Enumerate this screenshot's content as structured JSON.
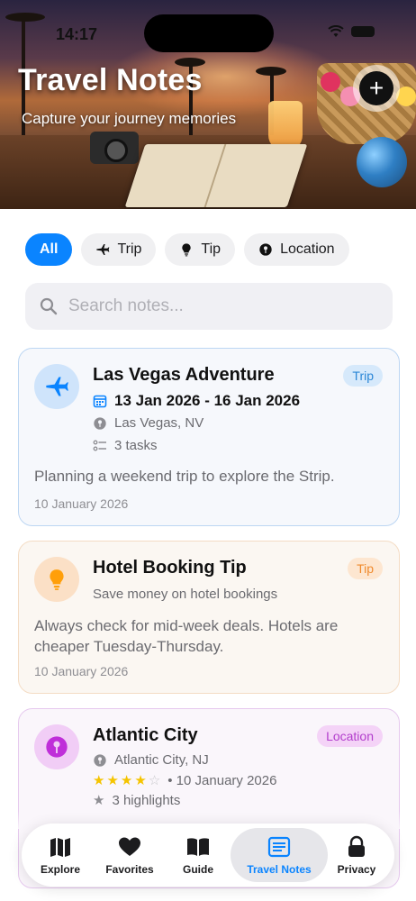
{
  "status_bar": {
    "time": "14:17"
  },
  "header": {
    "title": "Travel Notes",
    "subtitle": "Capture your journey memories",
    "add_button_icon": "plus-icon"
  },
  "filters": [
    {
      "label": "All",
      "icon": "",
      "active": true
    },
    {
      "label": "Trip",
      "icon": "airplane-icon",
      "active": false
    },
    {
      "label": "Tip",
      "icon": "lightbulb-icon",
      "active": false
    },
    {
      "label": "Location",
      "icon": "pin-icon",
      "active": false
    }
  ],
  "search": {
    "placeholder": "Search notes..."
  },
  "notes": [
    {
      "type": "trip",
      "title": "Las Vegas Adventure",
      "badge": "Trip",
      "date_range": "13 Jan 2026 - 16 Jan 2026",
      "location": "Las Vegas, NV",
      "tasks": "3 tasks",
      "description": "Planning a weekend trip to explore the Strip.",
      "created": "10 January 2026",
      "accent": "#0a84ff"
    },
    {
      "type": "tip",
      "title": "Hotel Booking Tip",
      "badge": "Tip",
      "subtitle": "Save money on hotel bookings",
      "description": "Always check for mid-week deals. Hotels are cheaper Tuesday-Thursday.",
      "created": "10 January 2026",
      "accent": "#ff9f0a"
    },
    {
      "type": "location",
      "title": "Atlantic City",
      "badge": "Location",
      "location": "Atlantic City, NJ",
      "rating": 4,
      "rating_max": 5,
      "rating_date": "• 10 January 2026",
      "highlights": "3 highlights",
      "accent": "#bf5af2"
    }
  ],
  "tabbar": [
    {
      "label": "Explore",
      "icon": "map-icon",
      "active": false
    },
    {
      "label": "Favorites",
      "icon": "heart-icon",
      "active": false
    },
    {
      "label": "Guide",
      "icon": "book-icon",
      "active": false
    },
    {
      "label": "Travel Notes",
      "icon": "notes-icon",
      "active": true
    },
    {
      "label": "Privacy",
      "icon": "lock-icon",
      "active": false
    }
  ]
}
